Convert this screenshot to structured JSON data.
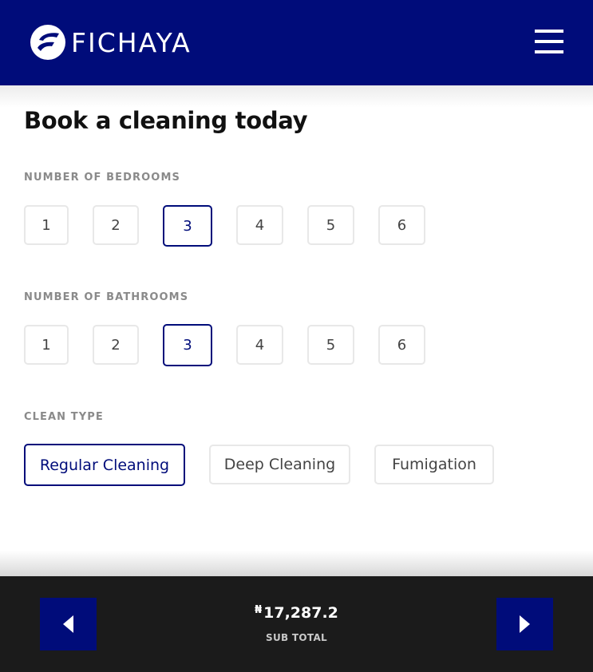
{
  "header": {
    "brand": "FICHAYA",
    "logo_icon": "fichaya-logo-icon",
    "menu_icon": "hamburger-menu-icon",
    "background_color": "#000c7a"
  },
  "page": {
    "title": "Book a cleaning today"
  },
  "bedrooms": {
    "label": "NUMBER OF BEDROOMS",
    "options": [
      "1",
      "2",
      "3",
      "4",
      "5",
      "6"
    ],
    "selected": "3"
  },
  "bathrooms": {
    "label": "NUMBER OF BATHROOMS",
    "options": [
      "1",
      "2",
      "3",
      "4",
      "5",
      "6"
    ],
    "selected": "3"
  },
  "clean_type": {
    "label": "CLEAN TYPE",
    "options": [
      "Regular Cleaning",
      "Deep Cleaning",
      "Fumigation"
    ],
    "selected": "Regular Cleaning"
  },
  "footer": {
    "currency_symbol": "₦",
    "subtotal": "17,287.2",
    "subtotal_label": "SUB TOTAL",
    "prev_icon": "arrow-left-icon",
    "next_icon": "arrow-right-icon",
    "accent_color": "#000c7a"
  }
}
